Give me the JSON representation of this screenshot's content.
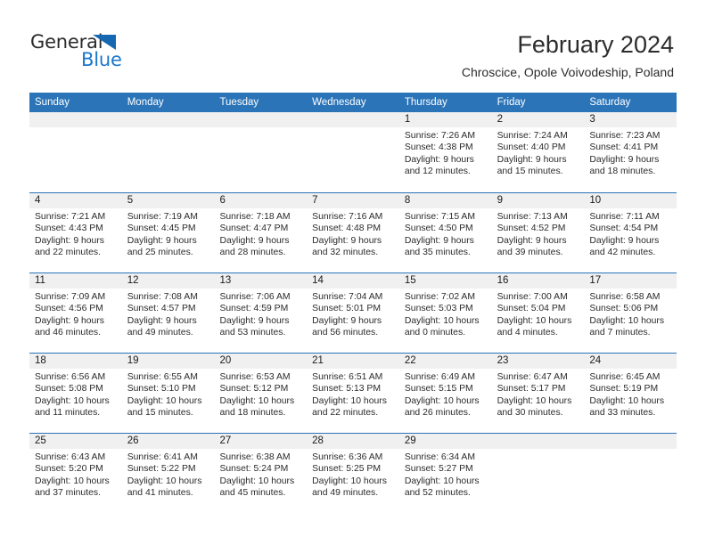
{
  "brand": {
    "name_top": "General",
    "name_bottom": "Blue",
    "accent_color": "#1b77cc",
    "triangle_color": "#1668b3"
  },
  "header": {
    "title": "February 2024",
    "subtitle": "Chroscice, Opole Voivodeship, Poland",
    "header_bg_color": "#2b74b8",
    "day_band_color": "#f0f0f0"
  },
  "weekdays": [
    "Sunday",
    "Monday",
    "Tuesday",
    "Wednesday",
    "Thursday",
    "Friday",
    "Saturday"
  ],
  "weeks": [
    [
      {
        "day": "",
        "empty": true
      },
      {
        "day": "",
        "empty": true
      },
      {
        "day": "",
        "empty": true
      },
      {
        "day": "",
        "empty": true
      },
      {
        "day": "1",
        "sunrise": "Sunrise: 7:26 AM",
        "sunset": "Sunset: 4:38 PM",
        "daylight_line1": "Daylight: 9 hours",
        "daylight_line2": "and 12 minutes."
      },
      {
        "day": "2",
        "sunrise": "Sunrise: 7:24 AM",
        "sunset": "Sunset: 4:40 PM",
        "daylight_line1": "Daylight: 9 hours",
        "daylight_line2": "and 15 minutes."
      },
      {
        "day": "3",
        "sunrise": "Sunrise: 7:23 AM",
        "sunset": "Sunset: 4:41 PM",
        "daylight_line1": "Daylight: 9 hours",
        "daylight_line2": "and 18 minutes."
      }
    ],
    [
      {
        "day": "4",
        "sunrise": "Sunrise: 7:21 AM",
        "sunset": "Sunset: 4:43 PM",
        "daylight_line1": "Daylight: 9 hours",
        "daylight_line2": "and 22 minutes."
      },
      {
        "day": "5",
        "sunrise": "Sunrise: 7:19 AM",
        "sunset": "Sunset: 4:45 PM",
        "daylight_line1": "Daylight: 9 hours",
        "daylight_line2": "and 25 minutes."
      },
      {
        "day": "6",
        "sunrise": "Sunrise: 7:18 AM",
        "sunset": "Sunset: 4:47 PM",
        "daylight_line1": "Daylight: 9 hours",
        "daylight_line2": "and 28 minutes."
      },
      {
        "day": "7",
        "sunrise": "Sunrise: 7:16 AM",
        "sunset": "Sunset: 4:48 PM",
        "daylight_line1": "Daylight: 9 hours",
        "daylight_line2": "and 32 minutes."
      },
      {
        "day": "8",
        "sunrise": "Sunrise: 7:15 AM",
        "sunset": "Sunset: 4:50 PM",
        "daylight_line1": "Daylight: 9 hours",
        "daylight_line2": "and 35 minutes."
      },
      {
        "day": "9",
        "sunrise": "Sunrise: 7:13 AM",
        "sunset": "Sunset: 4:52 PM",
        "daylight_line1": "Daylight: 9 hours",
        "daylight_line2": "and 39 minutes."
      },
      {
        "day": "10",
        "sunrise": "Sunrise: 7:11 AM",
        "sunset": "Sunset: 4:54 PM",
        "daylight_line1": "Daylight: 9 hours",
        "daylight_line2": "and 42 minutes."
      }
    ],
    [
      {
        "day": "11",
        "sunrise": "Sunrise: 7:09 AM",
        "sunset": "Sunset: 4:56 PM",
        "daylight_line1": "Daylight: 9 hours",
        "daylight_line2": "and 46 minutes."
      },
      {
        "day": "12",
        "sunrise": "Sunrise: 7:08 AM",
        "sunset": "Sunset: 4:57 PM",
        "daylight_line1": "Daylight: 9 hours",
        "daylight_line2": "and 49 minutes."
      },
      {
        "day": "13",
        "sunrise": "Sunrise: 7:06 AM",
        "sunset": "Sunset: 4:59 PM",
        "daylight_line1": "Daylight: 9 hours",
        "daylight_line2": "and 53 minutes."
      },
      {
        "day": "14",
        "sunrise": "Sunrise: 7:04 AM",
        "sunset": "Sunset: 5:01 PM",
        "daylight_line1": "Daylight: 9 hours",
        "daylight_line2": "and 56 minutes."
      },
      {
        "day": "15",
        "sunrise": "Sunrise: 7:02 AM",
        "sunset": "Sunset: 5:03 PM",
        "daylight_line1": "Daylight: 10 hours",
        "daylight_line2": "and 0 minutes."
      },
      {
        "day": "16",
        "sunrise": "Sunrise: 7:00 AM",
        "sunset": "Sunset: 5:04 PM",
        "daylight_line1": "Daylight: 10 hours",
        "daylight_line2": "and 4 minutes."
      },
      {
        "day": "17",
        "sunrise": "Sunrise: 6:58 AM",
        "sunset": "Sunset: 5:06 PM",
        "daylight_line1": "Daylight: 10 hours",
        "daylight_line2": "and 7 minutes."
      }
    ],
    [
      {
        "day": "18",
        "sunrise": "Sunrise: 6:56 AM",
        "sunset": "Sunset: 5:08 PM",
        "daylight_line1": "Daylight: 10 hours",
        "daylight_line2": "and 11 minutes."
      },
      {
        "day": "19",
        "sunrise": "Sunrise: 6:55 AM",
        "sunset": "Sunset: 5:10 PM",
        "daylight_line1": "Daylight: 10 hours",
        "daylight_line2": "and 15 minutes."
      },
      {
        "day": "20",
        "sunrise": "Sunrise: 6:53 AM",
        "sunset": "Sunset: 5:12 PM",
        "daylight_line1": "Daylight: 10 hours",
        "daylight_line2": "and 18 minutes."
      },
      {
        "day": "21",
        "sunrise": "Sunrise: 6:51 AM",
        "sunset": "Sunset: 5:13 PM",
        "daylight_line1": "Daylight: 10 hours",
        "daylight_line2": "and 22 minutes."
      },
      {
        "day": "22",
        "sunrise": "Sunrise: 6:49 AM",
        "sunset": "Sunset: 5:15 PM",
        "daylight_line1": "Daylight: 10 hours",
        "daylight_line2": "and 26 minutes."
      },
      {
        "day": "23",
        "sunrise": "Sunrise: 6:47 AM",
        "sunset": "Sunset: 5:17 PM",
        "daylight_line1": "Daylight: 10 hours",
        "daylight_line2": "and 30 minutes."
      },
      {
        "day": "24",
        "sunrise": "Sunrise: 6:45 AM",
        "sunset": "Sunset: 5:19 PM",
        "daylight_line1": "Daylight: 10 hours",
        "daylight_line2": "and 33 minutes."
      }
    ],
    [
      {
        "day": "25",
        "sunrise": "Sunrise: 6:43 AM",
        "sunset": "Sunset: 5:20 PM",
        "daylight_line1": "Daylight: 10 hours",
        "daylight_line2": "and 37 minutes."
      },
      {
        "day": "26",
        "sunrise": "Sunrise: 6:41 AM",
        "sunset": "Sunset: 5:22 PM",
        "daylight_line1": "Daylight: 10 hours",
        "daylight_line2": "and 41 minutes."
      },
      {
        "day": "27",
        "sunrise": "Sunrise: 6:38 AM",
        "sunset": "Sunset: 5:24 PM",
        "daylight_line1": "Daylight: 10 hours",
        "daylight_line2": "and 45 minutes."
      },
      {
        "day": "28",
        "sunrise": "Sunrise: 6:36 AM",
        "sunset": "Sunset: 5:25 PM",
        "daylight_line1": "Daylight: 10 hours",
        "daylight_line2": "and 49 minutes."
      },
      {
        "day": "29",
        "sunrise": "Sunrise: 6:34 AM",
        "sunset": "Sunset: 5:27 PM",
        "daylight_line1": "Daylight: 10 hours",
        "daylight_line2": "and 52 minutes."
      },
      {
        "day": "",
        "empty": true
      },
      {
        "day": "",
        "empty": true
      }
    ]
  ]
}
